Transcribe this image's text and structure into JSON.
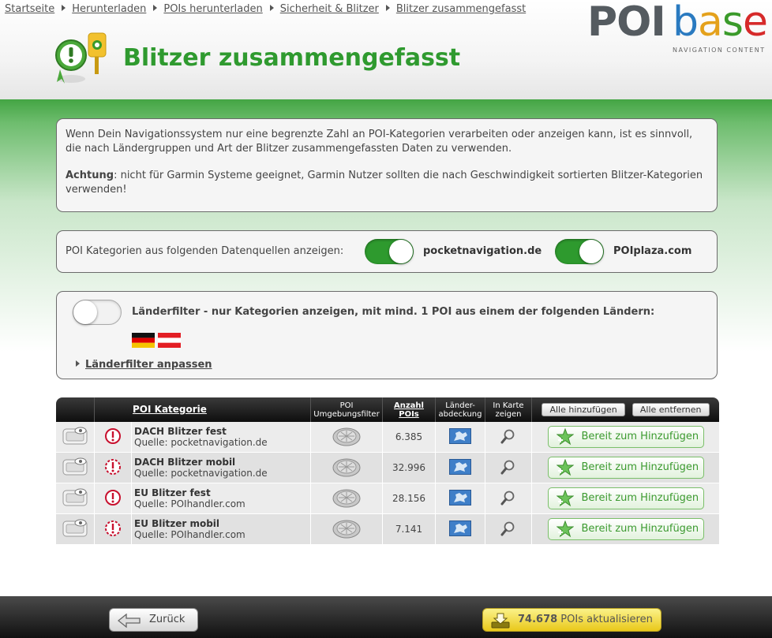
{
  "breadcrumb": [
    "Startseite",
    "Herunterladen",
    "POIs herunterladen",
    "Sicherheit & Blitzer",
    "Blitzer zusammengefasst"
  ],
  "logo": {
    "poi": "POI",
    "base": [
      "b",
      "a",
      "s",
      "e"
    ],
    "tagline": "NAVIGATION CONTENT"
  },
  "title": "Blitzer zusammengefasst",
  "info": {
    "p1": "Wenn Dein Navigationssystem nur eine begrenzte Zahl an POI-Kategorien verarbeiten oder anzeigen kann, ist es sinnvoll, die nach Ländergruppen und Art der Blitzer zusammengefassten Daten zu verwenden.",
    "p2_bold": "Achtung",
    "p2_rest": ": nicht für Garmin Systeme geeignet, Garmin Nutzer sollten die nach Geschwindigkeit sortierten Blitzer-Kategorien verwenden!"
  },
  "sources": {
    "label": "POI Kategorien aus folgenden Datenquellen anzeigen:",
    "items": [
      {
        "name": "pocketnavigation.de",
        "enabled": true
      },
      {
        "name": "POIplaza.com",
        "enabled": true
      }
    ]
  },
  "country_filter": {
    "enabled": false,
    "text": "Länderfilter - nur Kategorien anzeigen, mit mind. 1 POI aus einem der folgenden Ländern:",
    "flags": [
      "flag-germany",
      "flag-austria"
    ],
    "adjust_label": "Länderfilter anpassen"
  },
  "table": {
    "headers": {
      "category": "POI Kategorie",
      "filter": "POI Umgebungsfilter",
      "count": "Anzahl POIs",
      "coverage": "Länder-abdeckung",
      "map": "In Karte zeigen",
      "add_all": "Alle hinzufügen",
      "remove_all": "Alle entfernen"
    },
    "rows": [
      {
        "name": "DACH Blitzer fest",
        "source": "Quelle: pocketnavigation.de",
        "count": "6.385",
        "type": "fixed",
        "status": "Bereit zum Hinzufügen"
      },
      {
        "name": "DACH Blitzer mobil",
        "source": "Quelle: pocketnavigation.de",
        "count": "32.996",
        "type": "mobile",
        "status": "Bereit zum Hinzufügen"
      },
      {
        "name": "EU Blitzer fest",
        "source": "Quelle: POIhandler.com",
        "count": "28.156",
        "type": "fixed",
        "status": "Bereit zum Hinzufügen"
      },
      {
        "name": "EU Blitzer mobil",
        "source": "Quelle: POIhandler.com",
        "count": "7.141",
        "type": "mobile",
        "status": "Bereit zum Hinzufügen"
      }
    ]
  },
  "footer": {
    "back_label": "Zurück",
    "update_count": "74.678",
    "update_label": " POIs aktualisieren"
  },
  "colors": {
    "accent_green": "#2f9a2f",
    "update_yellow": "#f0d63a"
  }
}
